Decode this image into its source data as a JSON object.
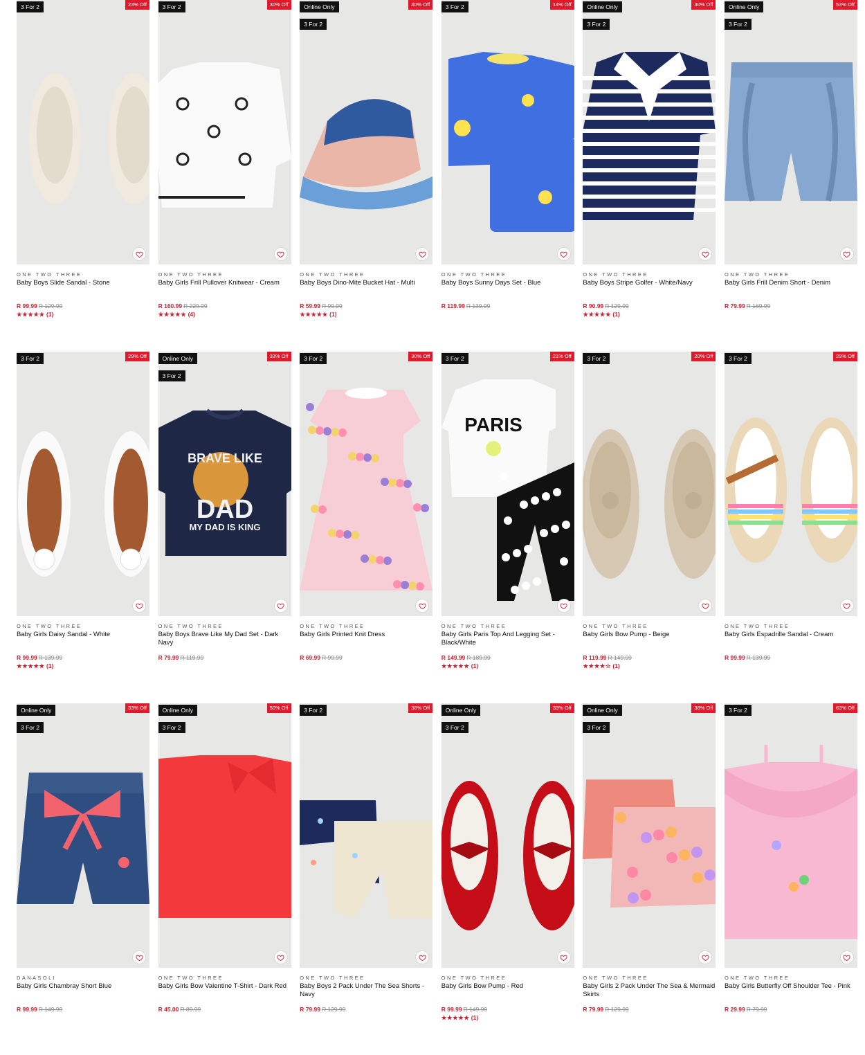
{
  "icons": {
    "wishlist": "heart-icon",
    "star": "star-icon"
  },
  "colors": {
    "sale_badge": "#e01a2b",
    "price": "#d31d2c",
    "promo_badge": "#111111",
    "image_bg": "#e7e7e5"
  },
  "products": [
    {
      "promos": [
        "3 For 2"
      ],
      "discount": "23% Off",
      "brand": "ONE TWO THREE",
      "name": "Baby Boys Slide Sandal - Stone",
      "price": "R 99.99",
      "was": "R 129.99",
      "rating": 5,
      "stars": "★★★★★",
      "reviews": "(1)",
      "image": "slides"
    },
    {
      "promos": [
        "3 For 2"
      ],
      "discount": "30% Off",
      "brand": "ONE TWO THREE",
      "name": "Baby Girls Frill Pullover Knitwear - Cream",
      "price": "R 160.99",
      "was": "R 229.99",
      "rating": 5,
      "stars": "★★★★★",
      "reviews": "(4)",
      "image": "knit"
    },
    {
      "promos": [
        "Online Only",
        "3 For 2"
      ],
      "discount": "40% Off",
      "brand": "ONE TWO THREE",
      "name": "Baby Boys Dino-Mite Bucket Hat - Multi",
      "price": "R 59.99",
      "was": "R 99.99",
      "rating": 5,
      "stars": "★★★★★",
      "reviews": "(1)",
      "image": "hat"
    },
    {
      "promos": [
        "3 For 2"
      ],
      "discount": "14% Off",
      "brand": "ONE TWO THREE",
      "name": "Baby Boys Sunny Days Set - Blue",
      "price": "R 119.99",
      "was": "R 139.99",
      "rating": null,
      "stars": "",
      "reviews": "",
      "image": "blueset"
    },
    {
      "promos": [
        "Online Only",
        "3 For 2"
      ],
      "discount": "30% Off",
      "brand": "ONE TWO THREE",
      "name": "Baby Boys Stripe Golfer - White/Navy",
      "price": "R 90.99",
      "was": "R 129.99",
      "rating": 5,
      "stars": "★★★★★",
      "reviews": "(1)",
      "image": "golfer"
    },
    {
      "promos": [
        "Online Only",
        "3 For 2"
      ],
      "discount": "53% Off",
      "brand": "ONE TWO THREE",
      "name": "Baby Girls Frill Denim Short - Denim",
      "price": "R 79.99",
      "was": "R 169.99",
      "rating": null,
      "stars": "",
      "reviews": "",
      "image": "denimshort"
    },
    {
      "promos": [
        "3 For 2"
      ],
      "discount": "29% Off",
      "brand": "ONE TWO THREE",
      "name": "Baby Girls Daisy Sandal - White",
      "price": "R 99.99",
      "was": "R 139.99",
      "rating": 5,
      "stars": "★★★★★",
      "reviews": "(1)",
      "image": "whitesandal"
    },
    {
      "promos": [
        "Online Only",
        "3 For 2"
      ],
      "discount": "33% Off",
      "brand": "ONE TWO THREE",
      "name": "Baby Boys Brave Like My Dad Set - Dark Navy",
      "price": "R 79.99",
      "was": "R 119.99",
      "rating": null,
      "stars": "",
      "reviews": "",
      "image": "navytee",
      "tee_text": [
        "BRAVE LIKE",
        "DAD",
        "MY DAD IS KING"
      ]
    },
    {
      "promos": [
        "3 For 2"
      ],
      "discount": "30% Off",
      "brand": "ONE TWO THREE",
      "name": "Baby Girls Printed Knit Dress",
      "price": "R 69.99",
      "was": "R 99.99",
      "rating": null,
      "stars": "",
      "reviews": "",
      "image": "dress"
    },
    {
      "promos": [
        "3 For 2"
      ],
      "discount": "21% Off",
      "brand": "ONE TWO THREE",
      "name": "Baby Girls Paris Top And Legging Set - Black/White",
      "price": "R 149.99",
      "was": "R 189.99",
      "rating": 5,
      "stars": "★★★★★",
      "reviews": "(1)",
      "image": "paris",
      "tee_text": [
        "PARIS"
      ]
    },
    {
      "promos": [
        "3 For 2"
      ],
      "discount": "20% Off",
      "brand": "ONE TWO THREE",
      "name": "Baby Girls Bow Pump - Beige",
      "price": "R 119.99",
      "was": "R 149.99",
      "rating": 4.5,
      "stars": "★★★★☆",
      "reviews": "(1)",
      "image": "beigepump"
    },
    {
      "promos": [
        "3 For 2"
      ],
      "discount": "29% Off",
      "brand": "ONE TWO THREE",
      "name": "Baby Girls Espadrille Sandal - Cream",
      "price": "R 99.99",
      "was": "R 139.99",
      "rating": null,
      "stars": "",
      "reviews": "",
      "image": "espadrille"
    },
    {
      "promos": [
        "Online Only",
        "3 For 2"
      ],
      "discount": "33% Off",
      "brand": "DANASOLI",
      "name": "Baby Girls Chambray Short Blue",
      "price": "R 99.99",
      "was": "R 149.99",
      "rating": null,
      "stars": "",
      "reviews": "",
      "image": "chambray"
    },
    {
      "promos": [
        "Online Only",
        "3 For 2"
      ],
      "discount": "50% Off",
      "brand": "ONE TWO THREE",
      "name": "Baby Girls Bow Valentine T-Shirt - Dark Red",
      "price": "R 45.00",
      "was": "R 89.99",
      "rating": null,
      "stars": "",
      "reviews": "",
      "image": "redtee"
    },
    {
      "promos": [
        "3 For 2"
      ],
      "discount": "38% Off",
      "brand": "ONE TWO THREE",
      "name": "Baby Boys 2 Pack Under The Sea Shorts - Navy",
      "price": "R 79.99",
      "was": "R 129.99",
      "rating": null,
      "stars": "",
      "reviews": "",
      "image": "seashorts"
    },
    {
      "promos": [
        "Online Only",
        "3 For 2"
      ],
      "discount": "33% Off",
      "brand": "ONE TWO THREE",
      "name": "Baby Girls Bow Pump - Red",
      "price": "R 99.99",
      "was": "R 149.99",
      "rating": 5,
      "stars": "★★★★★",
      "reviews": "(1)",
      "image": "redpump"
    },
    {
      "promos": [
        "Online Only",
        "3 For 2"
      ],
      "discount": "38% Off",
      "brand": "ONE TWO THREE",
      "name": "Baby Girls 2 Pack Under The Sea & Mermaid Skirts",
      "price": "R 79.99",
      "was": "R 129.99",
      "rating": null,
      "stars": "",
      "reviews": "",
      "image": "skirts"
    },
    {
      "promos": [
        "3 For 2"
      ],
      "discount": "63% Off",
      "brand": "ONE TWO THREE",
      "name": "Baby Girls Butterfly Off Shoulder Tee - Pink",
      "price": "R 29.99",
      "was": "R 79.99",
      "rating": null,
      "stars": "",
      "reviews": "",
      "image": "pinktee"
    }
  ]
}
